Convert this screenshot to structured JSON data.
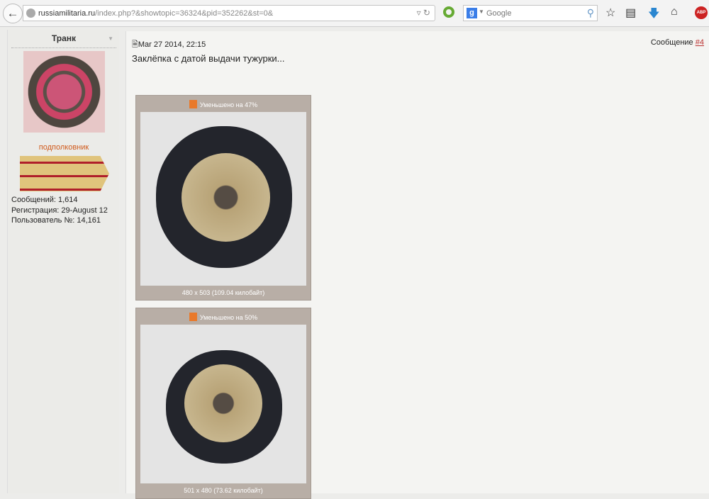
{
  "browser": {
    "url_domain": "russiamilitaria.ru",
    "url_path": "/index.php?&showtopic=36324&pid=352262&st=0&",
    "search_placeholder": "Google"
  },
  "sidebar": {
    "username": "Транк",
    "rank": "подполковник",
    "stats": [
      "Сообщений: 1,614",
      "Регистрация: 29-August 12",
      "Пользователь №: 14,161"
    ]
  },
  "post": {
    "date": "Mar 27 2014, 22:15",
    "message_label": "Сообщение",
    "message_number": "#4",
    "text": "Заклёпка с датой выдачи тужурки...",
    "images": [
      {
        "caption": "Уменьшено на 47%",
        "info": "480 x 503 (109.04 килобайт)"
      },
      {
        "caption": "Уменьшено на 50%",
        "info": "501 x 480 (73.62 килобайт)"
      }
    ]
  }
}
